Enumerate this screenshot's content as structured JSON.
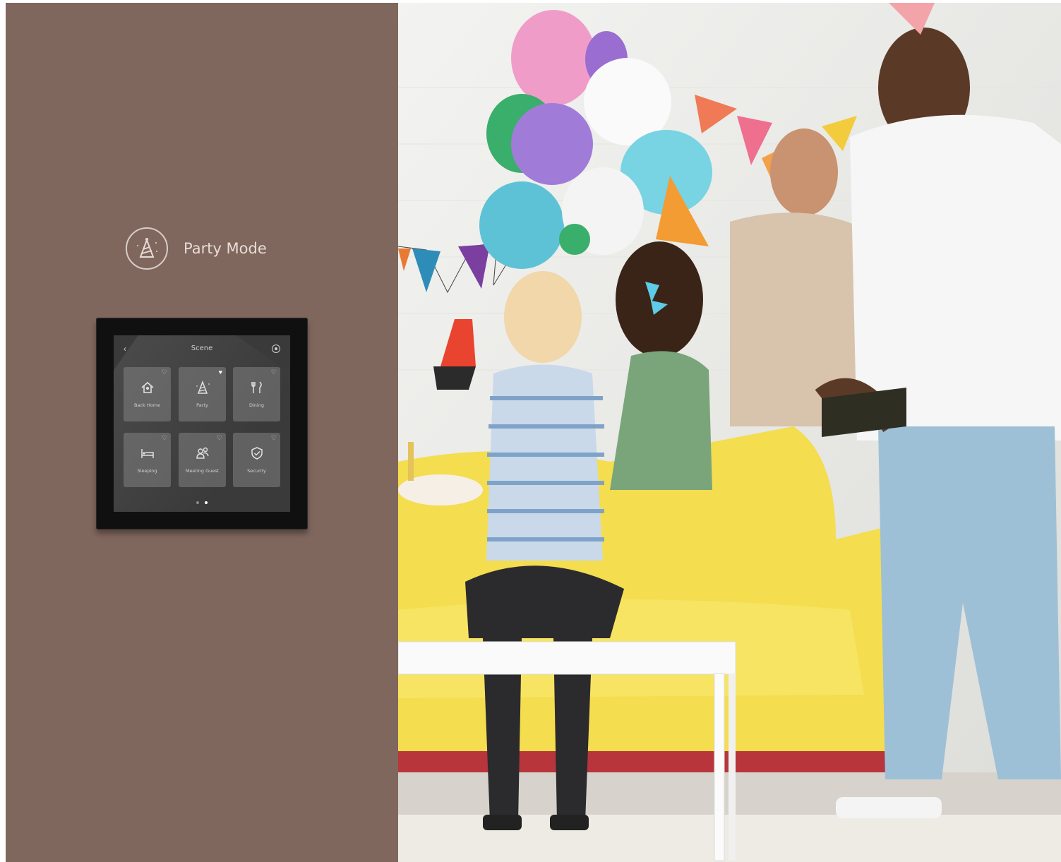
{
  "mode": {
    "title": "Party Mode",
    "icon": "party-hat-icon"
  },
  "panel": {
    "title": "Scene",
    "back_icon": "chevron-left-icon",
    "settings_icon": "settings-icon",
    "tiles": [
      {
        "label": "Back Home",
        "icon": "home-icon",
        "favorite": false
      },
      {
        "label": "Party",
        "icon": "party-hat-icon",
        "favorite": true
      },
      {
        "label": "Dining",
        "icon": "cutlery-icon",
        "favorite": false
      },
      {
        "label": "Sleeping",
        "icon": "bed-icon",
        "favorite": false
      },
      {
        "label": "Meeting Guest",
        "icon": "guests-icon",
        "favorite": false
      },
      {
        "label": "Security",
        "icon": "shield-check-icon",
        "favorite": false
      }
    ],
    "page_count": 2,
    "current_page": 2
  },
  "colors": {
    "brand_brown": "#80675e",
    "sofa_yellow": "#f4dd4f"
  }
}
